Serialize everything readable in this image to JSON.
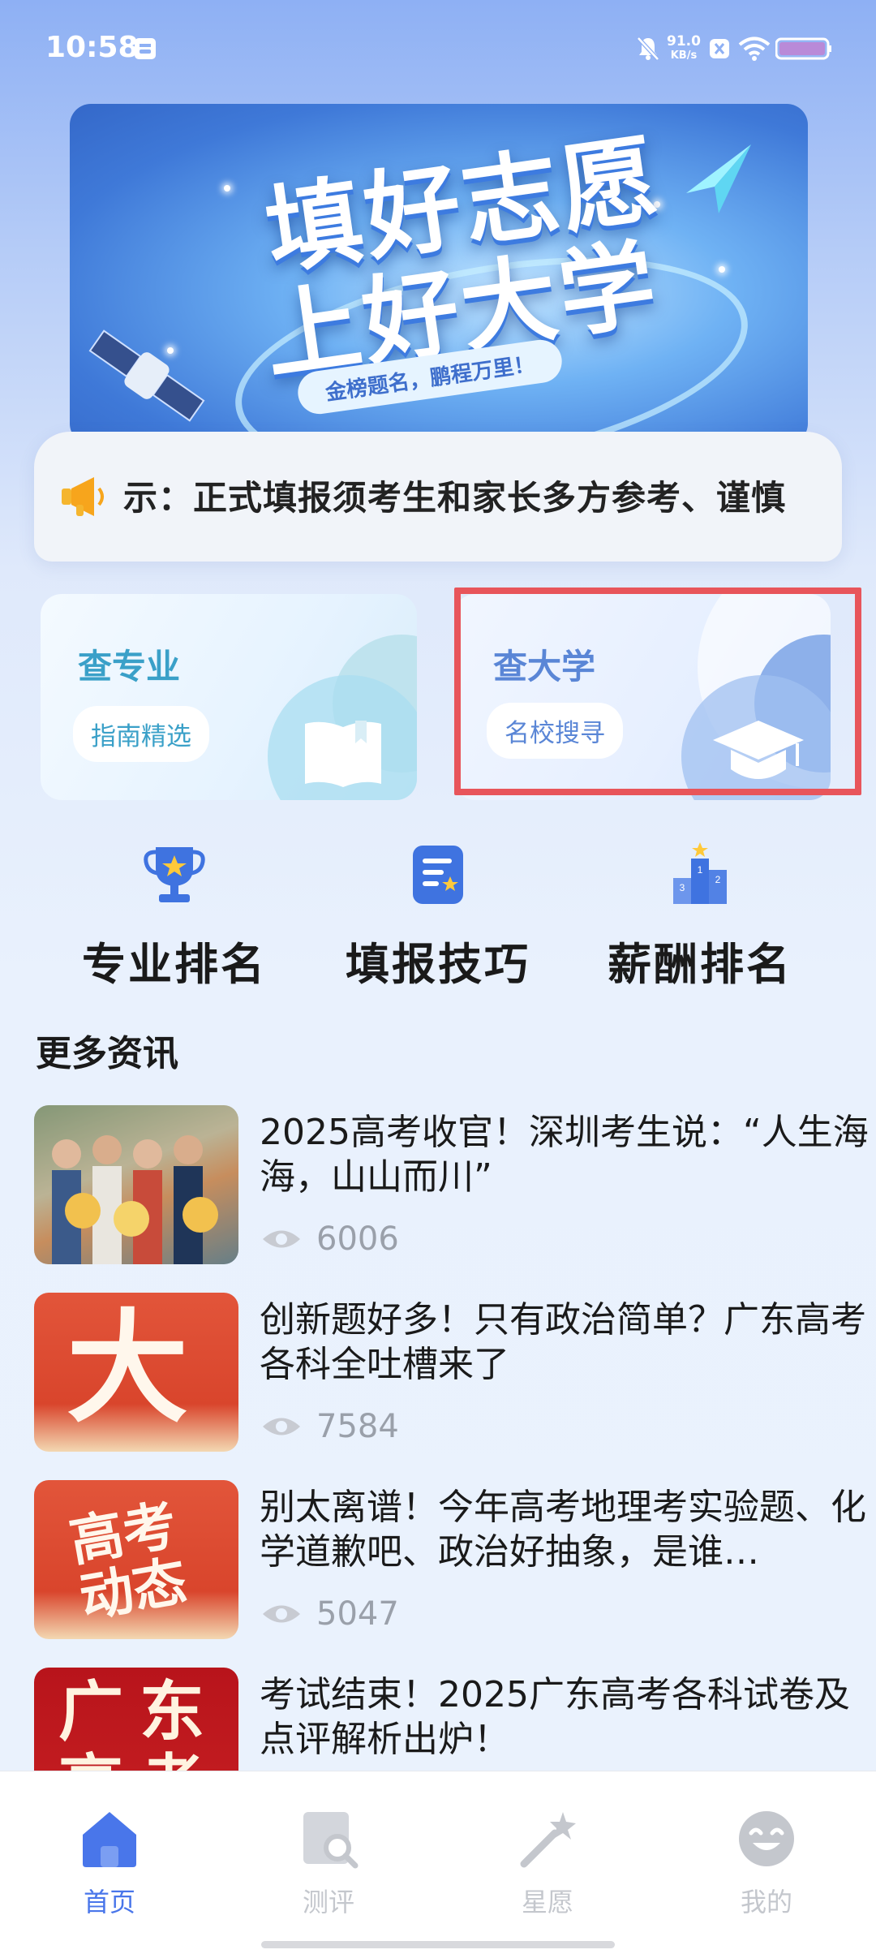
{
  "status_bar": {
    "time": "10:58",
    "net_speed_value": "91.0",
    "net_speed_unit": "KB/s"
  },
  "banner": {
    "title_line1": "填好志愿",
    "title_line2": "上好大学",
    "subtitle": "金榜题名，鹏程万里！"
  },
  "notice": {
    "text": "示：正式填报须考生和家长多方参考、谨慎",
    "icon": "megaphone-icon"
  },
  "cards": [
    {
      "title": "查专业",
      "tag": "指南精选",
      "icon": "book-icon"
    },
    {
      "title": "查大学",
      "tag": "名校搜寻",
      "icon": "graduation-cap-icon"
    }
  ],
  "quick_links": [
    {
      "label": "专业排名",
      "icon": "trophy-icon"
    },
    {
      "label": "填报技巧",
      "icon": "document-icon"
    },
    {
      "label": "薪酬排名",
      "icon": "podium-icon"
    }
  ],
  "section": {
    "title": "更多资讯"
  },
  "news": [
    {
      "title": "2025高考收官！深圳考生说：“人生海海，山山而川”",
      "views": "6006"
    },
    {
      "title": "创新题好多！只有政治简单？广东高考各科全吐槽来了",
      "views": "7584",
      "thumb_text": "大"
    },
    {
      "title": "别太离谱！今年高考地理考实验题、化学道歉吧、政治好抽象，是谁…",
      "views": "5047",
      "thumb_text_line1": "高考",
      "thumb_text_line2": "动态"
    },
    {
      "title": "考试结束！2025广东高考各科试卷及点评解析出炉！",
      "views": "",
      "thumb_text_line1": "广东",
      "thumb_text_line2": "高考"
    }
  ],
  "bottom_nav": [
    {
      "label": "首页",
      "icon": "home-icon",
      "active": true
    },
    {
      "label": "测评",
      "icon": "search-book-icon",
      "active": false
    },
    {
      "label": "星愿",
      "icon": "magic-wand-icon",
      "active": false
    },
    {
      "label": "我的",
      "icon": "smiley-icon",
      "active": false
    }
  ],
  "colors": {
    "accent": "#4976ea",
    "highlight_border": "#e8555b",
    "major_card": "#3aa0c8",
    "uni_card": "#5a86d6"
  }
}
